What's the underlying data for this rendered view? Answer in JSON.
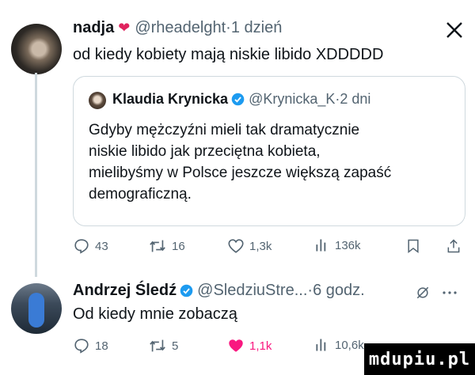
{
  "tweet1": {
    "author_name": "nadja",
    "author_emoji": "❤️‍🔥",
    "handle": "@rheadelght",
    "separator": " · ",
    "time": "1 dzień",
    "text": "od kiedy kobiety mają niskie libido XDDDDD"
  },
  "close_icon": "X",
  "quote": {
    "author_name": "Klaudia Krynicka",
    "handle": "@Krynicka_K",
    "separator": " · ",
    "time": "2 dni",
    "lines": [
      "Gdyby mężczyźni mieli tak dramatycznie",
      "niskie libido jak przeciętna kobieta,",
      "mielibyśmy w Polsce jeszcze większą zapaść",
      "demograficzną."
    ]
  },
  "tweet1_actions": {
    "replies": "43",
    "retweets": "16",
    "likes": "1,3k",
    "views": "136k"
  },
  "tweet2": {
    "author_name": "Andrzej Śledź",
    "handle": "@SledziuStre...",
    "separator": " · ",
    "time": "6 godz.",
    "text": "Od kiedy mnie zobaczą"
  },
  "tweet2_actions": {
    "replies": "18",
    "retweets": "5",
    "likes": "1,1k",
    "views": "10,6k"
  },
  "watermark": "mdupiu.pl",
  "colors": {
    "verified": "#1d9bf0",
    "like_active": "#f91880",
    "muted": "#536471",
    "border": "#cfd9de"
  }
}
